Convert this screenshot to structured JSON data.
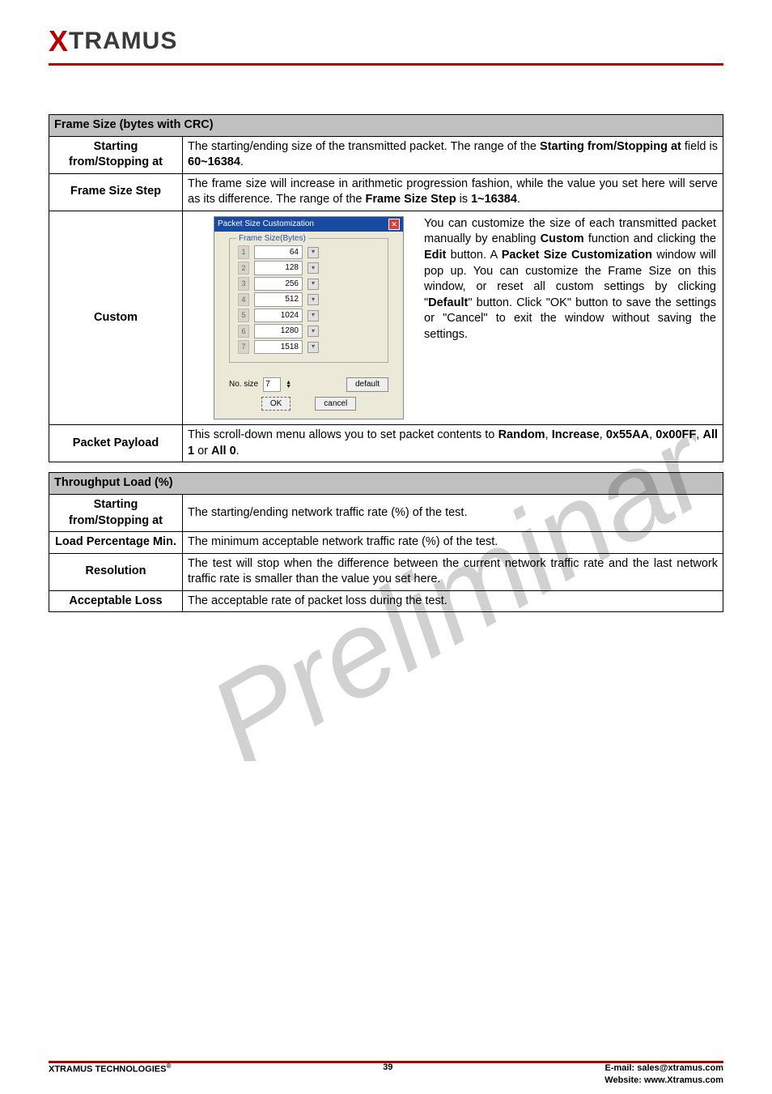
{
  "logo": {
    "x": "X",
    "rest": "TRAMUS"
  },
  "table1": {
    "header": "Frame Size (bytes with CRC)",
    "rows": [
      {
        "label": "Starting from/Stopping at",
        "text_pre": "The starting/ending size of the transmitted packet. The range of the ",
        "text_b1": "Starting from/Stopping at",
        "text_mid": " field is ",
        "text_b2": "60~16384",
        "text_post": "."
      },
      {
        "label": "Frame Size Step",
        "text_pre": "The frame size will increase in arithmetic progression fashion, while the value you set here will serve as its difference. The range of the ",
        "text_b1": "Frame Size Step",
        "text_mid": " is ",
        "text_b2": "1~16384",
        "text_post": "."
      },
      {
        "label": "Custom",
        "dialog": {
          "title": "Packet Size Customization",
          "group_legend": "Frame Size(Bytes)",
          "items": [
            {
              "n": "1",
              "v": "64"
            },
            {
              "n": "2",
              "v": "128"
            },
            {
              "n": "3",
              "v": "256"
            },
            {
              "n": "4",
              "v": "512"
            },
            {
              "n": "5",
              "v": "1024"
            },
            {
              "n": "6",
              "v": "1280"
            },
            {
              "n": "7",
              "v": "1518"
            }
          ],
          "no_label": "No. size",
          "no_value": "7",
          "default_btn": "default",
          "ok_btn": "OK",
          "cancel_btn": "cancel"
        },
        "text": {
          "p1": "You can customize the size of each transmitted packet manually by enabling ",
          "b1": "Custom",
          "p2": " function and clicking the ",
          "b2": "Edit",
          "p3": " button. A ",
          "b3": "Packet Size Customization",
          "p4": " window will pop up. You can customize the Frame Size on this window, or reset all custom settings by clicking \"",
          "b4": "Default",
          "p5": "\" button. Click \"OK\" button to save the settings or \"Cancel\" to exit the window without saving the settings."
        }
      },
      {
        "label": "Packet Payload",
        "text_pre": "This scroll-down menu allows you to set packet contents to ",
        "b1": "Random",
        "c1": ", ",
        "b2": "Increase",
        "c2": ", ",
        "b3": "0x55AA",
        "c3": ", ",
        "b4": "0x00FF",
        "c4": ", ",
        "b5": "All 1",
        "c5": " or ",
        "b6": "All 0",
        "text_post": "."
      }
    ]
  },
  "table2": {
    "header": "Throughput Load (%)",
    "rows": [
      {
        "label": "Starting from/Stopping at",
        "text": "The starting/ending network traffic rate (%) of the test."
      },
      {
        "label": "Load Percentage Min.",
        "text": "The minimum acceptable network traffic rate (%) of the test."
      },
      {
        "label": "Resolution",
        "text": "The test will stop when the difference between the current network traffic rate and the last network traffic rate is smaller than the value you set here."
      },
      {
        "label": "Acceptable Loss",
        "text": "The acceptable rate of packet loss during the test."
      }
    ]
  },
  "footer": {
    "left": "XTRAMUS TECHNOLOGIES",
    "sup": "®",
    "page": "39",
    "email_lbl": "E-mail: ",
    "email": "sales@xtramus.com",
    "web_lbl": "Website:  ",
    "web": "www.Xtramus.com"
  },
  "watermark_text": "Preliminary"
}
